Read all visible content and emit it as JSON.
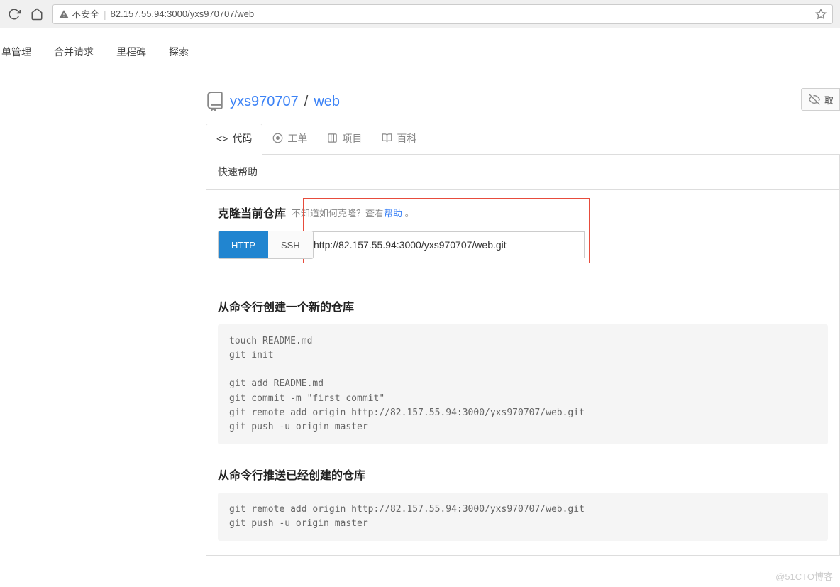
{
  "browser": {
    "security_label": "不安全",
    "url": "82.157.55.94:3000/yxs970707/web"
  },
  "topnav": {
    "items": [
      "单管理",
      "合并请求",
      "里程碑",
      "探索"
    ]
  },
  "repo": {
    "owner": "yxs970707",
    "name": "web",
    "unwatch_label": "取"
  },
  "tabs": {
    "code": "代码",
    "issues": "工单",
    "projects": "项目",
    "wiki": "百科"
  },
  "quick_help": {
    "title": "快速帮助",
    "clone_heading": "克隆当前仓库",
    "clone_hint_prefix": "不知道如何克隆？查看",
    "clone_hint_link": "帮助",
    "clone_hint_suffix": " 。",
    "http_label": "HTTP",
    "ssh_label": "SSH",
    "clone_url": "http://82.157.55.94:3000/yxs970707/web.git",
    "create_heading": "从命令行创建一个新的仓库",
    "create_code": "touch README.md\ngit init\n\ngit add README.md\ngit commit -m \"first commit\"\ngit remote add origin http://82.157.55.94:3000/yxs970707/web.git\ngit push -u origin master",
    "push_heading": "从命令行推送已经创建的仓库",
    "push_code": "git remote add origin http://82.157.55.94:3000/yxs970707/web.git\ngit push -u origin master"
  },
  "watermark": "@51CTO博客"
}
